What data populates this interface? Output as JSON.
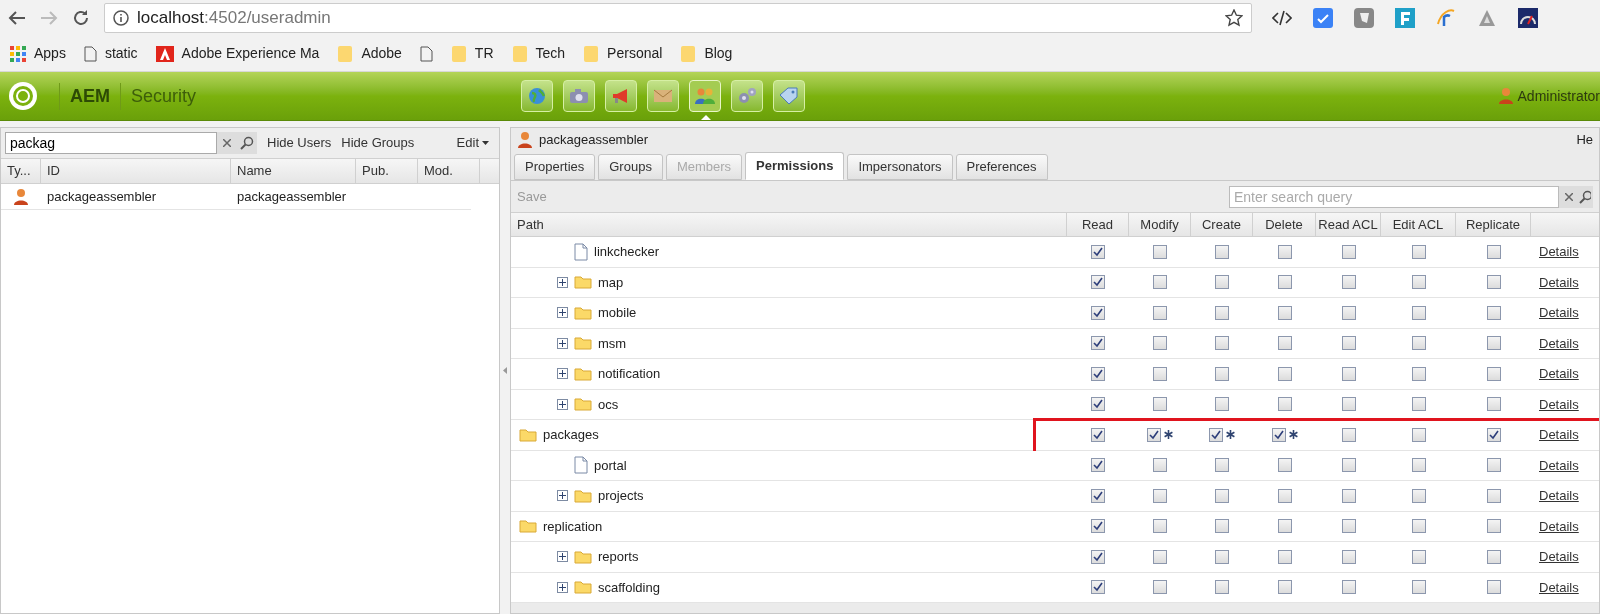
{
  "browser": {
    "url_host": "localhost",
    "url_rest": ":4502/useradmin",
    "bookmarks": [
      {
        "kind": "apps",
        "label": "Apps"
      },
      {
        "kind": "page",
        "label": "static"
      },
      {
        "kind": "adobe",
        "label": "Adobe Experience Ma"
      },
      {
        "kind": "folder",
        "label": "Adobe"
      },
      {
        "kind": "page"
      },
      {
        "kind": "folder",
        "label": "TR"
      },
      {
        "kind": "folder",
        "label": "Tech"
      },
      {
        "kind": "folder",
        "label": "Personal"
      },
      {
        "kind": "folder",
        "label": "Blog"
      }
    ]
  },
  "app_bar": {
    "brand": "AEM",
    "section": "Security",
    "user": "Administrator",
    "nav": [
      {
        "selected": false
      },
      {
        "selected": false
      },
      {
        "selected": false
      },
      {
        "selected": false
      },
      {
        "selected": true
      },
      {
        "selected": false
      },
      {
        "selected": false
      }
    ]
  },
  "left_panel": {
    "search": "packag",
    "links": [
      "Hide Users",
      "Hide Groups"
    ],
    "edit_menu": "Edit",
    "columns": [
      "Ty...",
      "ID",
      "Name",
      "Pub.",
      "Mod."
    ],
    "rows": [
      {
        "id": "packageassembler",
        "name": "packageassembler"
      }
    ]
  },
  "right_panel": {
    "title": "packageassembler",
    "help": "He",
    "tabs": [
      {
        "label": "Properties",
        "selected": false,
        "disabled": false
      },
      {
        "label": "Groups",
        "selected": false,
        "disabled": false
      },
      {
        "label": "Members",
        "selected": false,
        "disabled": true
      },
      {
        "label": "Permissions",
        "selected": true,
        "disabled": false
      },
      {
        "label": "Impersonators",
        "selected": false,
        "disabled": false
      },
      {
        "label": "Preferences",
        "selected": false,
        "disabled": false
      }
    ],
    "save": "Save",
    "search_placeholder": "Enter search query",
    "columns": [
      "Path",
      "Read",
      "Modify",
      "Create",
      "Delete",
      "Read ACL",
      "Edit ACL",
      "Replicate"
    ],
    "tree": [
      {
        "children": [
          {
            "name": "linkchecker",
            "kind": "file",
            "details": "Details",
            "perms": [
              true,
              false,
              false,
              false,
              false,
              false,
              false
            ]
          },
          {
            "name": "map",
            "kind": "folder",
            "collapsed": true,
            "details": "Details",
            "perms": [
              true,
              false,
              false,
              false,
              false,
              false,
              false
            ]
          },
          {
            "name": "mobile",
            "kind": "folder",
            "collapsed": true,
            "details": "Details",
            "perms": [
              true,
              false,
              false,
              false,
              false,
              false,
              false
            ]
          },
          {
            "name": "msm",
            "kind": "folder",
            "collapsed": true,
            "details": "Details",
            "perms": [
              true,
              false,
              false,
              false,
              false,
              false,
              false
            ]
          },
          {
            "name": "notification",
            "kind": "folder",
            "collapsed": true,
            "details": "Details",
            "perms": [
              true,
              false,
              false,
              false,
              false,
              false,
              false
            ]
          },
          {
            "name": "ocs",
            "kind": "folder",
            "collapsed": true,
            "details": "Details",
            "perms": [
              true,
              false,
              false,
              false,
              false,
              false,
              false
            ]
          }
        ]
      },
      {
        "name": "packages",
        "kind": "folder",
        "collapsed": false,
        "highlighted": true,
        "details": "Details",
        "perms": [
          true,
          true,
          true,
          true,
          false,
          false,
          true
        ],
        "restricted": [
          false,
          true,
          true,
          true,
          false,
          false,
          false
        ],
        "children": [
          {
            "name": "portal",
            "kind": "file",
            "details": "Details",
            "perms": [
              true,
              false,
              false,
              false,
              false,
              false,
              false
            ]
          },
          {
            "name": "projects",
            "kind": "folder",
            "collapsed": true,
            "details": "Details",
            "perms": [
              true,
              false,
              false,
              false,
              false,
              false,
              false
            ]
          }
        ]
      },
      {
        "name": "replication",
        "kind": "folder",
        "collapsed": false,
        "details": "Details",
        "perms": [
          true,
          false,
          false,
          false,
          false,
          false,
          false
        ],
        "children": [
          {
            "name": "reports",
            "kind": "folder",
            "collapsed": true,
            "details": "Details",
            "perms": [
              true,
              false,
              false,
              false,
              false,
              false,
              false
            ]
          },
          {
            "name": "scaffolding",
            "kind": "folder",
            "collapsed": true,
            "details": "Details",
            "perms": [
              true,
              false,
              false,
              false,
              false,
              false,
              false
            ]
          }
        ]
      }
    ]
  }
}
